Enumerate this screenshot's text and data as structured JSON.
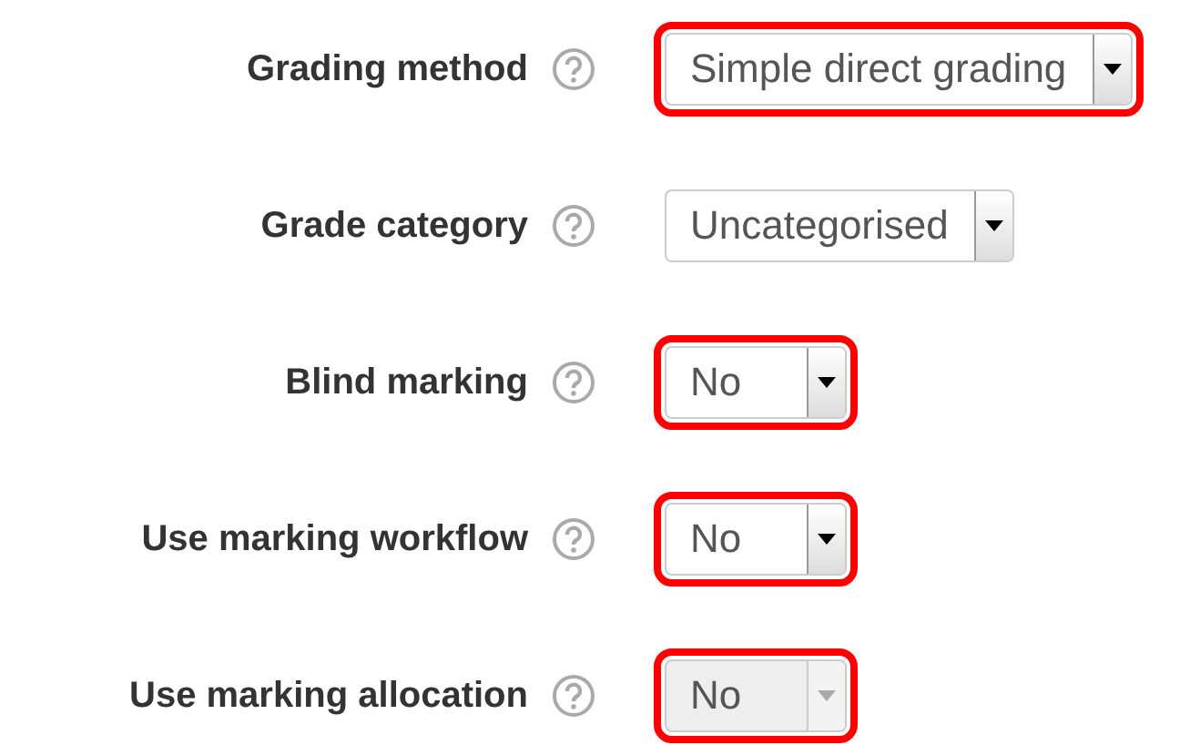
{
  "fields": [
    {
      "label": "Grading method",
      "value": "Simple direct grading",
      "highlighted": true,
      "disabled": false
    },
    {
      "label": "Grade category",
      "value": "Uncategorised",
      "highlighted": false,
      "disabled": false
    },
    {
      "label": "Blind marking",
      "value": "No",
      "highlighted": true,
      "disabled": false
    },
    {
      "label": "Use marking workflow",
      "value": "No",
      "highlighted": true,
      "disabled": false
    },
    {
      "label": "Use marking allocation",
      "value": "No",
      "highlighted": true,
      "disabled": true
    }
  ]
}
